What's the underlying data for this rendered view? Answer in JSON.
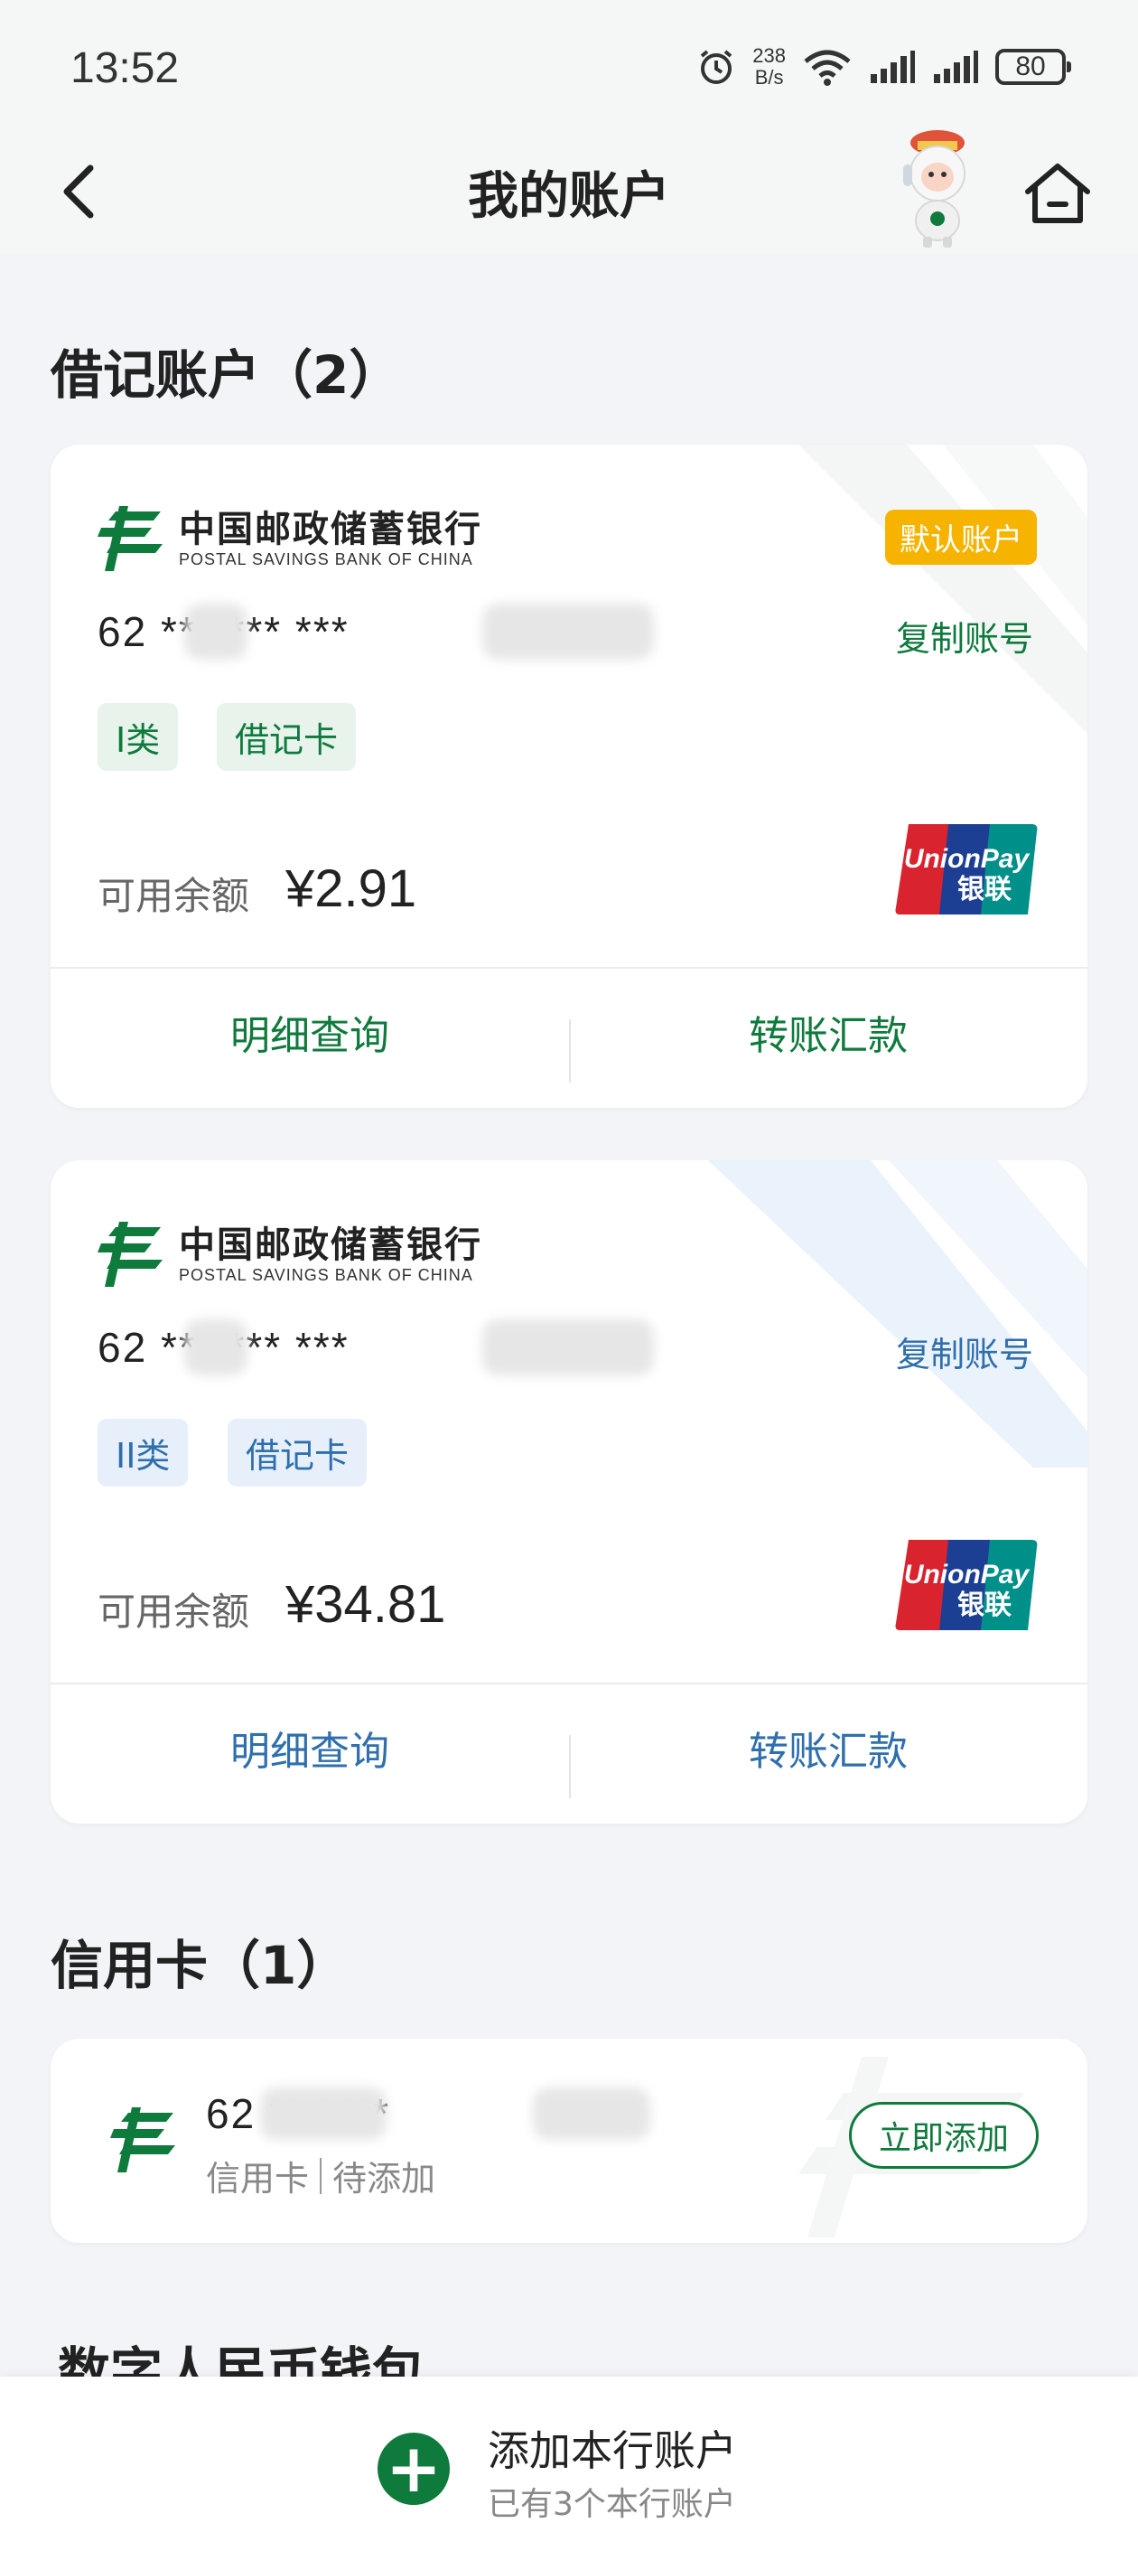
{
  "status_bar": {
    "time": "13:52",
    "net_speed_value": "238",
    "net_speed_unit": "B/s",
    "battery": "80",
    "icons": [
      "alarm-icon",
      "wifi-icon",
      "signal-icon",
      "signal-icon"
    ]
  },
  "header": {
    "title": "我的账户",
    "back_icon": "chevron-left-icon",
    "home_icon": "home-icon"
  },
  "debit_section": {
    "title": "借记账户（2）",
    "cards": [
      {
        "bank_name_cn": "中国邮政储蓄银行",
        "bank_name_en": "POSTAL SAVINGS BANK OF CHINA",
        "default_badge": "默认账户",
        "account_number": "62 ** **** ***",
        "copy_label": "复制账号",
        "tags": [
          "I类",
          "借记卡"
        ],
        "balance_label": "可用余额",
        "balance": "¥2.91",
        "actions": [
          "明细查询",
          "转账汇款"
        ],
        "accent_color": "#0e7a3c"
      },
      {
        "bank_name_cn": "中国邮政储蓄银行",
        "bank_name_en": "POSTAL SAVINGS BANK OF CHINA",
        "account_number": "62 ** **** ***",
        "copy_label": "复制账号",
        "tags": [
          "II类",
          "借记卡"
        ],
        "balance_label": "可用余额",
        "balance": "¥34.81",
        "actions": [
          "明细查询",
          "转账汇款"
        ],
        "accent_color": "#2f6fad"
      }
    ]
  },
  "credit_section": {
    "title": "信用卡（1）",
    "card": {
      "account_number": "62 ** ****",
      "type_label": "信用卡",
      "status_label": "待添加",
      "button_label": "立即添加"
    }
  },
  "wallet_section": {
    "title": "数字人民币钱包"
  },
  "bottom_bar": {
    "add_title": "添加本行账户",
    "add_sub": "已有3个本行账户",
    "add_icon": "plus-circle-icon"
  },
  "colors": {
    "brand_green": "#0e7a3c",
    "blue": "#2f6fad",
    "badge_yellow": "#f6b400",
    "background": "#f2f4f7"
  }
}
